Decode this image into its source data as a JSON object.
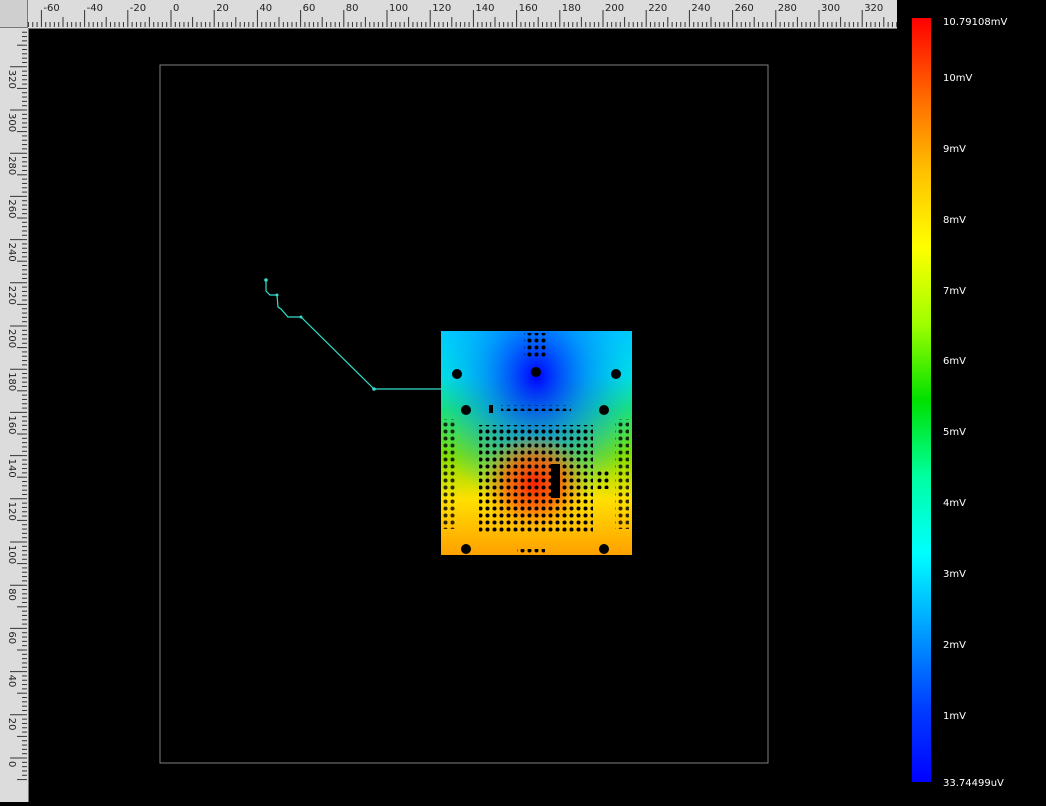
{
  "ruler_top": {
    "labels": [
      "-60",
      "-40",
      "-20",
      "0",
      "20",
      "40",
      "60",
      "80",
      "100",
      "120",
      "140",
      "160",
      "180",
      "200",
      "220",
      "240",
      "260",
      "280",
      "300",
      "320"
    ]
  },
  "ruler_left": {
    "labels": [
      "320",
      "300",
      "280",
      "260",
      "240",
      "220",
      "200",
      "180",
      "160",
      "140",
      "120",
      "100",
      "80",
      "60",
      "40",
      "20",
      "0"
    ]
  },
  "colorbar": {
    "max_label": "10.79108mV",
    "min_label": "33.74499uV",
    "ticks": [
      "10mV",
      "9mV",
      "8mV",
      "7mV",
      "6mV",
      "5mV",
      "4mV",
      "3mV",
      "2mV",
      "1mV"
    ],
    "colors": [
      "#ff0000",
      "#ff6600",
      "#ffc000",
      "#ffff00",
      "#a0ff00",
      "#00e000",
      "#00ffa0",
      "#00ffff",
      "#00a0ff",
      "#0040ff",
      "#0000ff"
    ]
  },
  "plot": {
    "board_outline_color": "#808080",
    "trace_color": "#33ddcc"
  }
}
